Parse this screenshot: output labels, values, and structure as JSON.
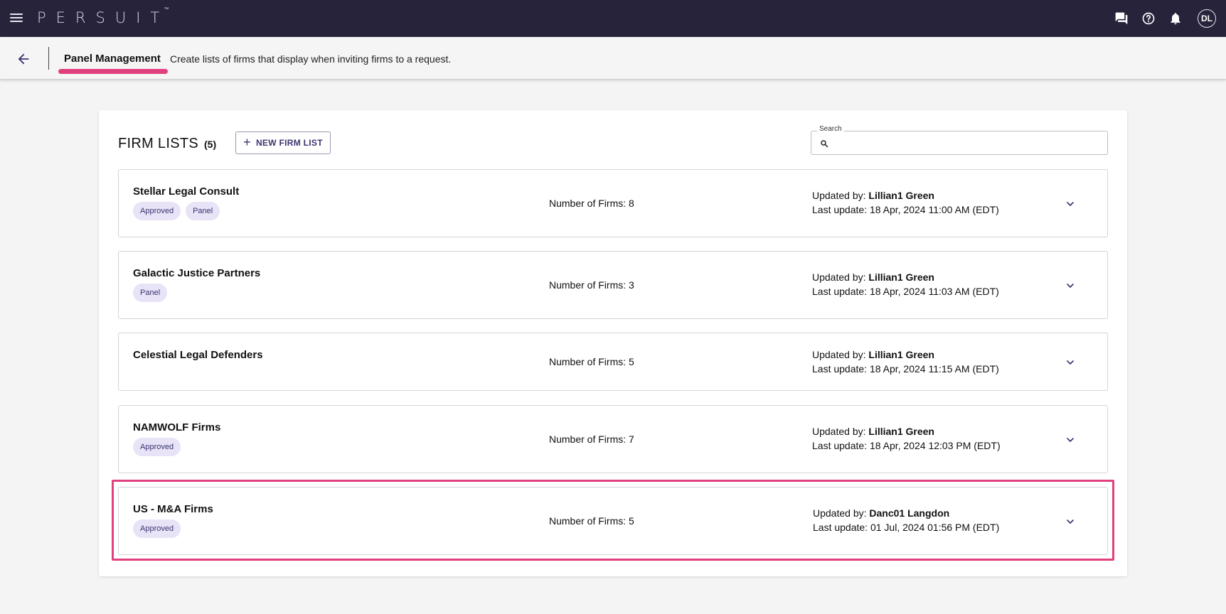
{
  "app": {
    "logo": "PERSUIT",
    "logo_tm": "™",
    "user_initials": "DL"
  },
  "subheader": {
    "title": "Panel Management",
    "description": "Create lists of firms that display when inviting firms to a request."
  },
  "firm_lists": {
    "title": "FIRM LISTS",
    "count": "(5)",
    "new_button_label": "NEW FIRM LIST",
    "search_label": "Search",
    "search_value": "",
    "items": [
      {
        "name": "Stellar Legal Consult",
        "badges": [
          "Approved",
          "Panel"
        ],
        "number_of_firms": "Number of Firms: 8",
        "updated_by_label": "Updated by:",
        "updated_by": "Lillian1 Green",
        "last_update": "Last update: 18 Apr, 2024 11:00 AM (EDT)"
      },
      {
        "name": "Galactic Justice Partners",
        "badges": [
          "Panel"
        ],
        "number_of_firms": "Number of Firms: 3",
        "updated_by_label": "Updated by:",
        "updated_by": "Lillian1 Green",
        "last_update": "Last update: 18 Apr, 2024 11:03 AM (EDT)"
      },
      {
        "name": "Celestial Legal Defenders",
        "badges": [],
        "number_of_firms": "Number of Firms: 5",
        "updated_by_label": "Updated by:",
        "updated_by": "Lillian1 Green",
        "last_update": "Last update: 18 Apr, 2024 11:15 AM (EDT)"
      },
      {
        "name": "NAMWOLF Firms",
        "badges": [
          "Approved"
        ],
        "number_of_firms": "Number of Firms: 7",
        "updated_by_label": "Updated by:",
        "updated_by": "Lillian1 Green",
        "last_update": "Last update: 18 Apr, 2024 12:03 PM (EDT)"
      },
      {
        "name": "US - M&A Firms",
        "badges": [
          "Approved"
        ],
        "number_of_firms": "Number of Firms: 5",
        "updated_by_label": "Updated by:",
        "updated_by": "Danc01 Langdon",
        "last_update": "Last update: 01 Jul, 2024 01:56 PM (EDT)"
      }
    ]
  },
  "colors": {
    "topbar": "#26233b",
    "accent_purple": "#3a3570",
    "badge_bg": "#e8e3f7",
    "highlight_pink": "#e0407e"
  },
  "icons": {
    "menu": "hamburger-menu-icon",
    "back": "arrow-left-icon",
    "chat": "chat-icon",
    "help": "help-circle-icon",
    "notifications": "bell-icon",
    "search": "search-icon",
    "expand": "chevron-down-icon",
    "add": "plus-icon"
  }
}
